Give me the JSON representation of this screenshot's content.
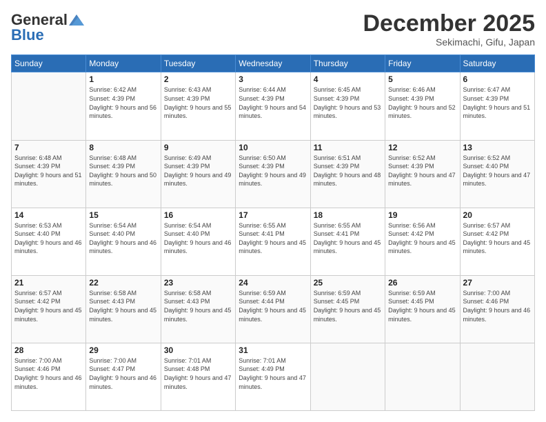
{
  "header": {
    "logo_general": "General",
    "logo_blue": "Blue",
    "month_title": "December 2025",
    "subtitle": "Sekimachi, Gifu, Japan"
  },
  "weekdays": [
    "Sunday",
    "Monday",
    "Tuesday",
    "Wednesday",
    "Thursday",
    "Friday",
    "Saturday"
  ],
  "weeks": [
    [
      {
        "day": "",
        "sunrise": "",
        "sunset": "",
        "daylight": ""
      },
      {
        "day": "1",
        "sunrise": "Sunrise: 6:42 AM",
        "sunset": "Sunset: 4:39 PM",
        "daylight": "Daylight: 9 hours and 56 minutes."
      },
      {
        "day": "2",
        "sunrise": "Sunrise: 6:43 AM",
        "sunset": "Sunset: 4:39 PM",
        "daylight": "Daylight: 9 hours and 55 minutes."
      },
      {
        "day": "3",
        "sunrise": "Sunrise: 6:44 AM",
        "sunset": "Sunset: 4:39 PM",
        "daylight": "Daylight: 9 hours and 54 minutes."
      },
      {
        "day": "4",
        "sunrise": "Sunrise: 6:45 AM",
        "sunset": "Sunset: 4:39 PM",
        "daylight": "Daylight: 9 hours and 53 minutes."
      },
      {
        "day": "5",
        "sunrise": "Sunrise: 6:46 AM",
        "sunset": "Sunset: 4:39 PM",
        "daylight": "Daylight: 9 hours and 52 minutes."
      },
      {
        "day": "6",
        "sunrise": "Sunrise: 6:47 AM",
        "sunset": "Sunset: 4:39 PM",
        "daylight": "Daylight: 9 hours and 51 minutes."
      }
    ],
    [
      {
        "day": "7",
        "sunrise": "Sunrise: 6:48 AM",
        "sunset": "Sunset: 4:39 PM",
        "daylight": "Daylight: 9 hours and 51 minutes."
      },
      {
        "day": "8",
        "sunrise": "Sunrise: 6:48 AM",
        "sunset": "Sunset: 4:39 PM",
        "daylight": "Daylight: 9 hours and 50 minutes."
      },
      {
        "day": "9",
        "sunrise": "Sunrise: 6:49 AM",
        "sunset": "Sunset: 4:39 PM",
        "daylight": "Daylight: 9 hours and 49 minutes."
      },
      {
        "day": "10",
        "sunrise": "Sunrise: 6:50 AM",
        "sunset": "Sunset: 4:39 PM",
        "daylight": "Daylight: 9 hours and 49 minutes."
      },
      {
        "day": "11",
        "sunrise": "Sunrise: 6:51 AM",
        "sunset": "Sunset: 4:39 PM",
        "daylight": "Daylight: 9 hours and 48 minutes."
      },
      {
        "day": "12",
        "sunrise": "Sunrise: 6:52 AM",
        "sunset": "Sunset: 4:39 PM",
        "daylight": "Daylight: 9 hours and 47 minutes."
      },
      {
        "day": "13",
        "sunrise": "Sunrise: 6:52 AM",
        "sunset": "Sunset: 4:40 PM",
        "daylight": "Daylight: 9 hours and 47 minutes."
      }
    ],
    [
      {
        "day": "14",
        "sunrise": "Sunrise: 6:53 AM",
        "sunset": "Sunset: 4:40 PM",
        "daylight": "Daylight: 9 hours and 46 minutes."
      },
      {
        "day": "15",
        "sunrise": "Sunrise: 6:54 AM",
        "sunset": "Sunset: 4:40 PM",
        "daylight": "Daylight: 9 hours and 46 minutes."
      },
      {
        "day": "16",
        "sunrise": "Sunrise: 6:54 AM",
        "sunset": "Sunset: 4:40 PM",
        "daylight": "Daylight: 9 hours and 46 minutes."
      },
      {
        "day": "17",
        "sunrise": "Sunrise: 6:55 AM",
        "sunset": "Sunset: 4:41 PM",
        "daylight": "Daylight: 9 hours and 45 minutes."
      },
      {
        "day": "18",
        "sunrise": "Sunrise: 6:55 AM",
        "sunset": "Sunset: 4:41 PM",
        "daylight": "Daylight: 9 hours and 45 minutes."
      },
      {
        "day": "19",
        "sunrise": "Sunrise: 6:56 AM",
        "sunset": "Sunset: 4:42 PM",
        "daylight": "Daylight: 9 hours and 45 minutes."
      },
      {
        "day": "20",
        "sunrise": "Sunrise: 6:57 AM",
        "sunset": "Sunset: 4:42 PM",
        "daylight": "Daylight: 9 hours and 45 minutes."
      }
    ],
    [
      {
        "day": "21",
        "sunrise": "Sunrise: 6:57 AM",
        "sunset": "Sunset: 4:42 PM",
        "daylight": "Daylight: 9 hours and 45 minutes."
      },
      {
        "day": "22",
        "sunrise": "Sunrise: 6:58 AM",
        "sunset": "Sunset: 4:43 PM",
        "daylight": "Daylight: 9 hours and 45 minutes."
      },
      {
        "day": "23",
        "sunrise": "Sunrise: 6:58 AM",
        "sunset": "Sunset: 4:43 PM",
        "daylight": "Daylight: 9 hours and 45 minutes."
      },
      {
        "day": "24",
        "sunrise": "Sunrise: 6:59 AM",
        "sunset": "Sunset: 4:44 PM",
        "daylight": "Daylight: 9 hours and 45 minutes."
      },
      {
        "day": "25",
        "sunrise": "Sunrise: 6:59 AM",
        "sunset": "Sunset: 4:45 PM",
        "daylight": "Daylight: 9 hours and 45 minutes."
      },
      {
        "day": "26",
        "sunrise": "Sunrise: 6:59 AM",
        "sunset": "Sunset: 4:45 PM",
        "daylight": "Daylight: 9 hours and 45 minutes."
      },
      {
        "day": "27",
        "sunrise": "Sunrise: 7:00 AM",
        "sunset": "Sunset: 4:46 PM",
        "daylight": "Daylight: 9 hours and 46 minutes."
      }
    ],
    [
      {
        "day": "28",
        "sunrise": "Sunrise: 7:00 AM",
        "sunset": "Sunset: 4:46 PM",
        "daylight": "Daylight: 9 hours and 46 minutes."
      },
      {
        "day": "29",
        "sunrise": "Sunrise: 7:00 AM",
        "sunset": "Sunset: 4:47 PM",
        "daylight": "Daylight: 9 hours and 46 minutes."
      },
      {
        "day": "30",
        "sunrise": "Sunrise: 7:01 AM",
        "sunset": "Sunset: 4:48 PM",
        "daylight": "Daylight: 9 hours and 47 minutes."
      },
      {
        "day": "31",
        "sunrise": "Sunrise: 7:01 AM",
        "sunset": "Sunset: 4:49 PM",
        "daylight": "Daylight: 9 hours and 47 minutes."
      },
      {
        "day": "",
        "sunrise": "",
        "sunset": "",
        "daylight": ""
      },
      {
        "day": "",
        "sunrise": "",
        "sunset": "",
        "daylight": ""
      },
      {
        "day": "",
        "sunrise": "",
        "sunset": "",
        "daylight": ""
      }
    ]
  ]
}
